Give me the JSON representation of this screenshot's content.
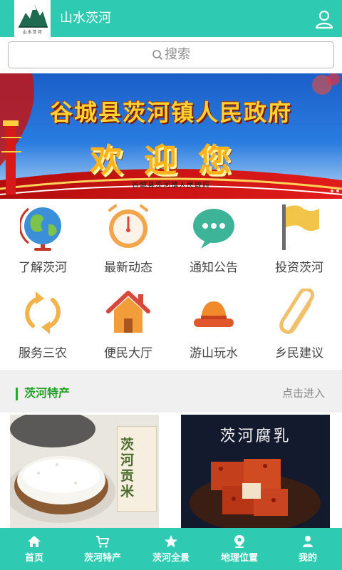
{
  "header": {
    "title": "山水茨河",
    "logo_text": "山水茨河",
    "user_icon": "user-icon",
    "background": "#2ecbb2"
  },
  "search": {
    "placeholder": "搜索",
    "icon": "search-icon"
  },
  "banner": {
    "title": "谷城县茨河镇人民政府",
    "welcome": "欢迎您",
    "subtitle": "谷城县茨河镇人民政府",
    "slide_count": 2
  },
  "menu": [
    {
      "label": "了解茨河",
      "icon": "globe-icon"
    },
    {
      "label": "最新动态",
      "icon": "stopwatch-icon"
    },
    {
      "label": "通知公告",
      "icon": "chat-bubble-icon"
    },
    {
      "label": "投资茨河",
      "icon": "flag-icon"
    },
    {
      "label": "服务三农",
      "icon": "refresh-arrows-icon"
    },
    {
      "label": "便民大厅",
      "icon": "house-icon"
    },
    {
      "label": "游山玩水",
      "icon": "hat-icon"
    },
    {
      "label": "乡民建议",
      "icon": "paperclip-icon"
    }
  ],
  "section": {
    "title": "茨河特产",
    "more": "点击进入",
    "accent": "#17b31e"
  },
  "products": [
    {
      "label": "茨河贡米",
      "image": "rice-photo"
    },
    {
      "label": "茨河腐乳",
      "image": "fermented-tofu-photo"
    }
  ],
  "tabbar": [
    {
      "label": "首页",
      "icon": "home-icon"
    },
    {
      "label": "茨河特产",
      "icon": "cart-icon"
    },
    {
      "label": "茨河全景",
      "icon": "star-icon"
    },
    {
      "label": "地理位置",
      "icon": "location-pin-icon"
    },
    {
      "label": "我的",
      "icon": "person-icon"
    }
  ]
}
